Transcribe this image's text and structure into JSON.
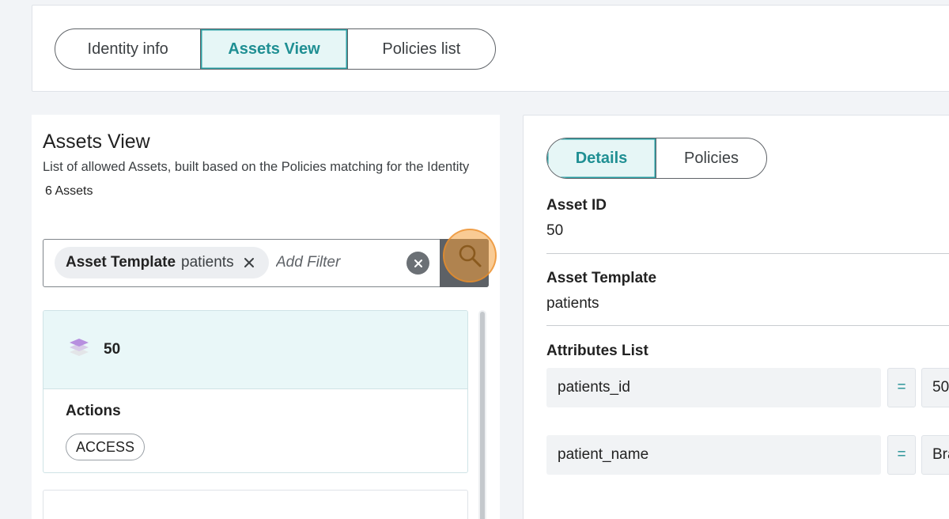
{
  "main_tabs": {
    "identity_info": "Identity info",
    "assets_view": "Assets View",
    "policies_list": "Policies list",
    "active": "assets_view"
  },
  "assets_panel": {
    "title": "Assets View",
    "subtitle": "List of allowed Assets, built based on the Policies matching for the Identity",
    "count": "6 Assets"
  },
  "filter": {
    "chip_key": "Asset Template",
    "chip_value": "patients",
    "placeholder": "Add Filter"
  },
  "asset_list": [
    {
      "id": "50",
      "actions_label": "Actions",
      "actions": [
        "ACCESS"
      ]
    }
  ],
  "details": {
    "tabs": {
      "details": "Details",
      "policies": "Policies",
      "active": "details"
    },
    "asset_id_label": "Asset ID",
    "asset_id_value": "50",
    "asset_template_label": "Asset Template",
    "asset_template_value": "patients",
    "attributes_label": "Attributes List",
    "attributes": [
      {
        "name": "patients_id",
        "op": "=",
        "value": "50"
      },
      {
        "name": "patient_name",
        "op": "=",
        "value": "Bra"
      }
    ]
  },
  "colors": {
    "accent": "#1f8f93",
    "active_tab_bg": "#e6f6f6",
    "card_highlight": "#e9f7f8",
    "search_button": "#5d6166",
    "click_highlight": "#f4a03c"
  }
}
